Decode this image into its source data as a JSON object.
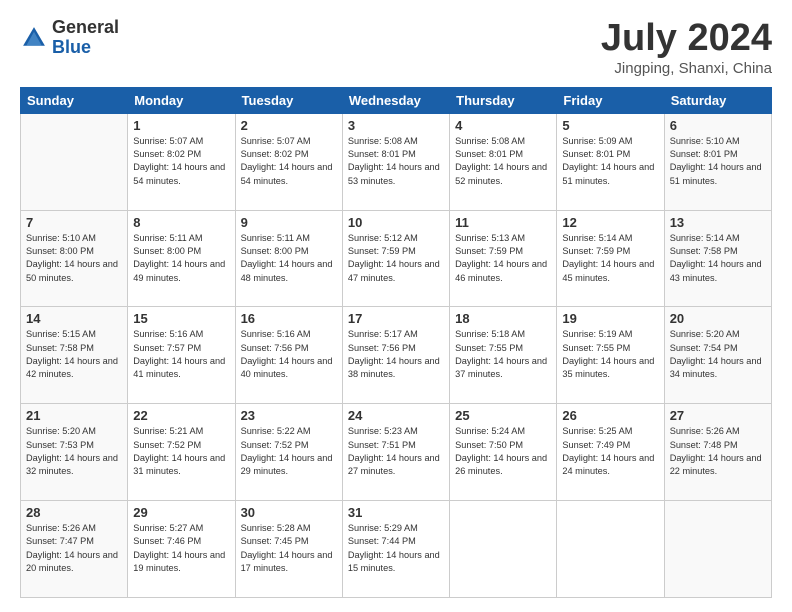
{
  "logo": {
    "general": "General",
    "blue": "Blue"
  },
  "title": {
    "month": "July 2024",
    "location": "Jingping, Shanxi, China"
  },
  "headers": [
    "Sunday",
    "Monday",
    "Tuesday",
    "Wednesday",
    "Thursday",
    "Friday",
    "Saturday"
  ],
  "weeks": [
    [
      {
        "day": "",
        "sunrise": "",
        "sunset": "",
        "daylight": ""
      },
      {
        "day": "1",
        "sunrise": "Sunrise: 5:07 AM",
        "sunset": "Sunset: 8:02 PM",
        "daylight": "Daylight: 14 hours and 54 minutes."
      },
      {
        "day": "2",
        "sunrise": "Sunrise: 5:07 AM",
        "sunset": "Sunset: 8:02 PM",
        "daylight": "Daylight: 14 hours and 54 minutes."
      },
      {
        "day": "3",
        "sunrise": "Sunrise: 5:08 AM",
        "sunset": "Sunset: 8:01 PM",
        "daylight": "Daylight: 14 hours and 53 minutes."
      },
      {
        "day": "4",
        "sunrise": "Sunrise: 5:08 AM",
        "sunset": "Sunset: 8:01 PM",
        "daylight": "Daylight: 14 hours and 52 minutes."
      },
      {
        "day": "5",
        "sunrise": "Sunrise: 5:09 AM",
        "sunset": "Sunset: 8:01 PM",
        "daylight": "Daylight: 14 hours and 51 minutes."
      },
      {
        "day": "6",
        "sunrise": "Sunrise: 5:10 AM",
        "sunset": "Sunset: 8:01 PM",
        "daylight": "Daylight: 14 hours and 51 minutes."
      }
    ],
    [
      {
        "day": "7",
        "sunrise": "Sunrise: 5:10 AM",
        "sunset": "Sunset: 8:00 PM",
        "daylight": "Daylight: 14 hours and 50 minutes."
      },
      {
        "day": "8",
        "sunrise": "Sunrise: 5:11 AM",
        "sunset": "Sunset: 8:00 PM",
        "daylight": "Daylight: 14 hours and 49 minutes."
      },
      {
        "day": "9",
        "sunrise": "Sunrise: 5:11 AM",
        "sunset": "Sunset: 8:00 PM",
        "daylight": "Daylight: 14 hours and 48 minutes."
      },
      {
        "day": "10",
        "sunrise": "Sunrise: 5:12 AM",
        "sunset": "Sunset: 7:59 PM",
        "daylight": "Daylight: 14 hours and 47 minutes."
      },
      {
        "day": "11",
        "sunrise": "Sunrise: 5:13 AM",
        "sunset": "Sunset: 7:59 PM",
        "daylight": "Daylight: 14 hours and 46 minutes."
      },
      {
        "day": "12",
        "sunrise": "Sunrise: 5:14 AM",
        "sunset": "Sunset: 7:59 PM",
        "daylight": "Daylight: 14 hours and 45 minutes."
      },
      {
        "day": "13",
        "sunrise": "Sunrise: 5:14 AM",
        "sunset": "Sunset: 7:58 PM",
        "daylight": "Daylight: 14 hours and 43 minutes."
      }
    ],
    [
      {
        "day": "14",
        "sunrise": "Sunrise: 5:15 AM",
        "sunset": "Sunset: 7:58 PM",
        "daylight": "Daylight: 14 hours and 42 minutes."
      },
      {
        "day": "15",
        "sunrise": "Sunrise: 5:16 AM",
        "sunset": "Sunset: 7:57 PM",
        "daylight": "Daylight: 14 hours and 41 minutes."
      },
      {
        "day": "16",
        "sunrise": "Sunrise: 5:16 AM",
        "sunset": "Sunset: 7:56 PM",
        "daylight": "Daylight: 14 hours and 40 minutes."
      },
      {
        "day": "17",
        "sunrise": "Sunrise: 5:17 AM",
        "sunset": "Sunset: 7:56 PM",
        "daylight": "Daylight: 14 hours and 38 minutes."
      },
      {
        "day": "18",
        "sunrise": "Sunrise: 5:18 AM",
        "sunset": "Sunset: 7:55 PM",
        "daylight": "Daylight: 14 hours and 37 minutes."
      },
      {
        "day": "19",
        "sunrise": "Sunrise: 5:19 AM",
        "sunset": "Sunset: 7:55 PM",
        "daylight": "Daylight: 14 hours and 35 minutes."
      },
      {
        "day": "20",
        "sunrise": "Sunrise: 5:20 AM",
        "sunset": "Sunset: 7:54 PM",
        "daylight": "Daylight: 14 hours and 34 minutes."
      }
    ],
    [
      {
        "day": "21",
        "sunrise": "Sunrise: 5:20 AM",
        "sunset": "Sunset: 7:53 PM",
        "daylight": "Daylight: 14 hours and 32 minutes."
      },
      {
        "day": "22",
        "sunrise": "Sunrise: 5:21 AM",
        "sunset": "Sunset: 7:52 PM",
        "daylight": "Daylight: 14 hours and 31 minutes."
      },
      {
        "day": "23",
        "sunrise": "Sunrise: 5:22 AM",
        "sunset": "Sunset: 7:52 PM",
        "daylight": "Daylight: 14 hours and 29 minutes."
      },
      {
        "day": "24",
        "sunrise": "Sunrise: 5:23 AM",
        "sunset": "Sunset: 7:51 PM",
        "daylight": "Daylight: 14 hours and 27 minutes."
      },
      {
        "day": "25",
        "sunrise": "Sunrise: 5:24 AM",
        "sunset": "Sunset: 7:50 PM",
        "daylight": "Daylight: 14 hours and 26 minutes."
      },
      {
        "day": "26",
        "sunrise": "Sunrise: 5:25 AM",
        "sunset": "Sunset: 7:49 PM",
        "daylight": "Daylight: 14 hours and 24 minutes."
      },
      {
        "day": "27",
        "sunrise": "Sunrise: 5:26 AM",
        "sunset": "Sunset: 7:48 PM",
        "daylight": "Daylight: 14 hours and 22 minutes."
      }
    ],
    [
      {
        "day": "28",
        "sunrise": "Sunrise: 5:26 AM",
        "sunset": "Sunset: 7:47 PM",
        "daylight": "Daylight: 14 hours and 20 minutes."
      },
      {
        "day": "29",
        "sunrise": "Sunrise: 5:27 AM",
        "sunset": "Sunset: 7:46 PM",
        "daylight": "Daylight: 14 hours and 19 minutes."
      },
      {
        "day": "30",
        "sunrise": "Sunrise: 5:28 AM",
        "sunset": "Sunset: 7:45 PM",
        "daylight": "Daylight: 14 hours and 17 minutes."
      },
      {
        "day": "31",
        "sunrise": "Sunrise: 5:29 AM",
        "sunset": "Sunset: 7:44 PM",
        "daylight": "Daylight: 14 hours and 15 minutes."
      },
      {
        "day": "",
        "sunrise": "",
        "sunset": "",
        "daylight": ""
      },
      {
        "day": "",
        "sunrise": "",
        "sunset": "",
        "daylight": ""
      },
      {
        "day": "",
        "sunrise": "",
        "sunset": "",
        "daylight": ""
      }
    ]
  ]
}
